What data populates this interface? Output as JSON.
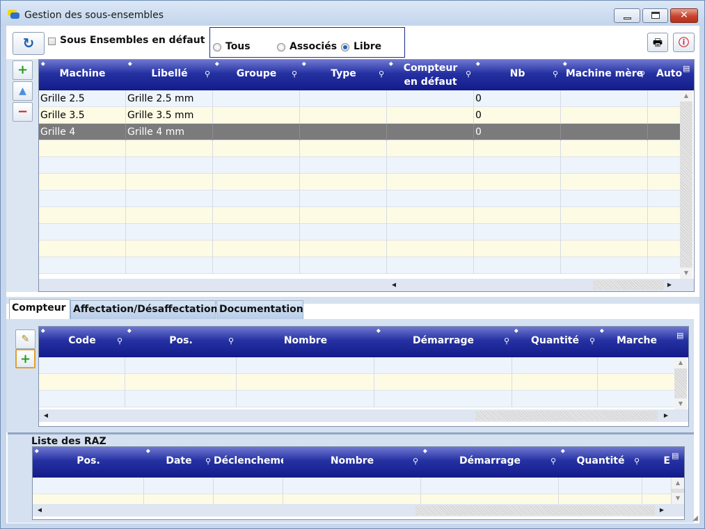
{
  "window": {
    "title": "Gestion des sous-ensembles",
    "close_glyph": "✕"
  },
  "toolbar": {
    "refresh_icon": "↻",
    "checkbox_label": "Sous Ensembles en défaut",
    "checkbox_checked": false,
    "filter": {
      "options": [
        "Tous",
        "Associés",
        "Libre"
      ],
      "selected": "Libre"
    },
    "print_icon": "🖶",
    "stop_icon": "ⓘ"
  },
  "side_buttons": {
    "add": "+",
    "up": "▲",
    "remove": "−"
  },
  "main_grid": {
    "columns": [
      "Machine",
      "Libellé",
      "Groupe",
      "Type",
      "Compteur en défaut",
      "Nb",
      "Machine mère",
      "Auto"
    ],
    "rows": [
      [
        "Grille 2.5",
        "Grille 2.5 mm",
        "",
        "",
        "",
        "0",
        "",
        ""
      ],
      [
        "Grille 3.5",
        "Grille 3.5 mm",
        "",
        "",
        "",
        "0",
        "",
        ""
      ],
      [
        "Grille 4",
        "Grille 4 mm",
        "",
        "",
        "",
        "0",
        "",
        ""
      ]
    ],
    "selected_row": 2
  },
  "tabs": [
    "Compteur",
    "Affectation/Désaffectation",
    "Documentation"
  ],
  "active_tab": "Compteur",
  "compteur_grid": {
    "columns": [
      "Code",
      "Pos.",
      "Nombre",
      "Démarrage",
      "Quantité",
      "Marche"
    ]
  },
  "raz": {
    "title": "Liste des RAZ",
    "columns": [
      "Pos.",
      "Date",
      "Déclenchement",
      "Nombre",
      "Démarrage",
      "Quantité",
      "E"
    ]
  }
}
